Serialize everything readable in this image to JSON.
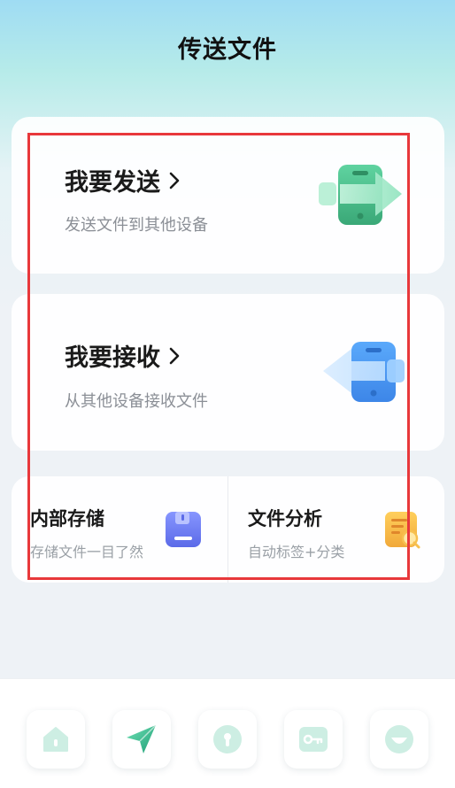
{
  "header": {
    "title": "传送文件"
  },
  "send_card": {
    "title": "我要发送",
    "subtitle": "发送文件到其他设备"
  },
  "receive_card": {
    "title": "我要接收",
    "subtitle": "从其他设备接收文件"
  },
  "tools": [
    {
      "title": "内部存储",
      "subtitle": "存储文件一目了然",
      "icon": "storage-icon"
    },
    {
      "title": "文件分析",
      "subtitle": "自动标签+分类",
      "icon": "document-search-icon"
    }
  ],
  "bottom_nav": [
    {
      "icon": "home-icon"
    },
    {
      "icon": "send-icon",
      "active": true
    },
    {
      "icon": "lock-icon"
    },
    {
      "icon": "key-icon"
    },
    {
      "icon": "smile-icon"
    }
  ],
  "colors": {
    "send_accent": "#4fc38f",
    "receive_accent": "#4a9cf5",
    "storage_accent": "#6b7df2",
    "analysis_accent": "#f5b642",
    "highlight": "#e8383b",
    "nav_icon": "#cdeee3"
  }
}
